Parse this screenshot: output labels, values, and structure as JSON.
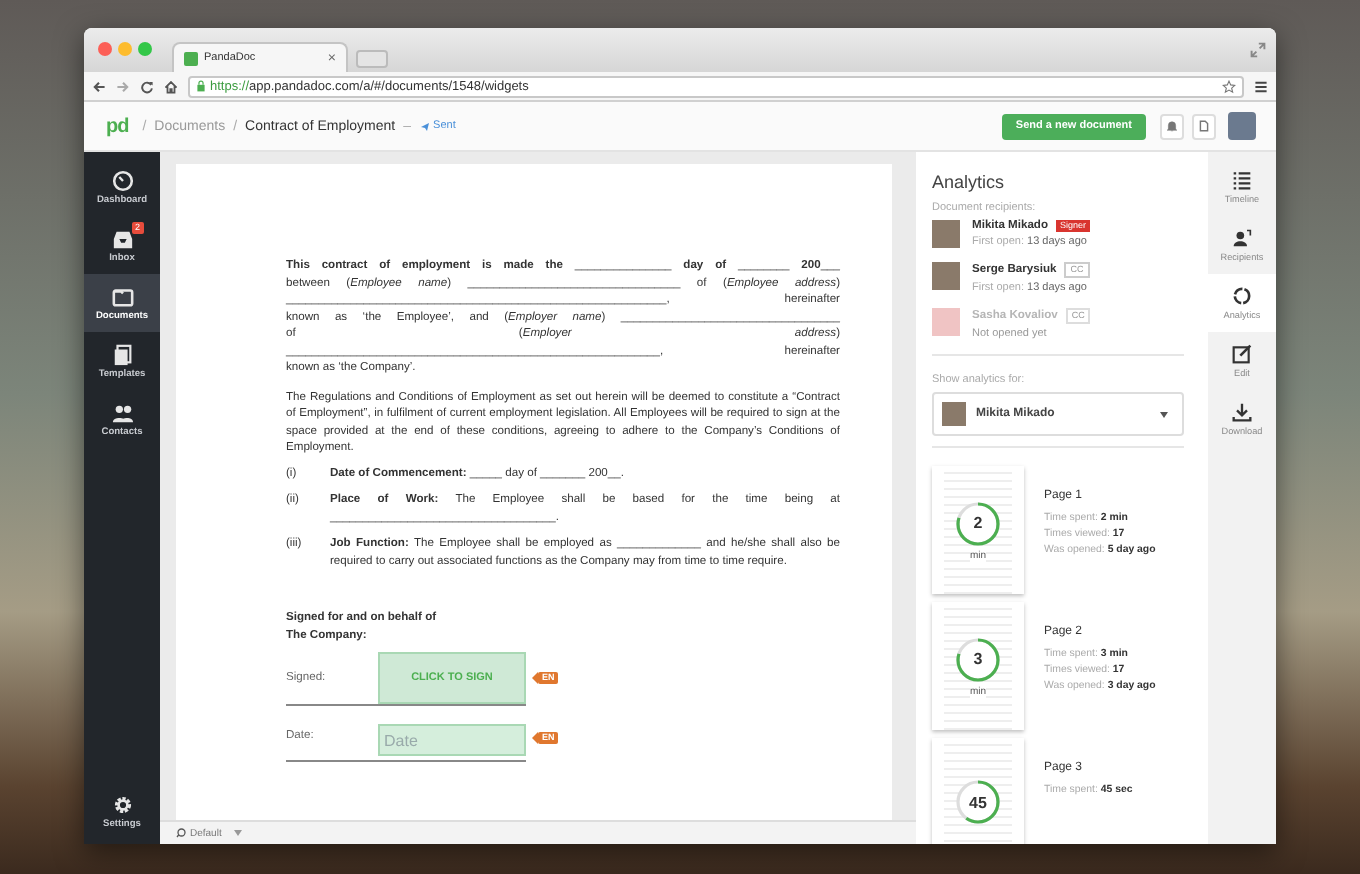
{
  "browser": {
    "tab_title": "PandaDoc",
    "tab_close": "×",
    "url_scheme": "https://",
    "url_rest": "app.pandadoc.com/a/#/documents/1548/widgets"
  },
  "header": {
    "logo": "pd",
    "breadcrumbs": [
      {
        "separator": "/",
        "label": "Documents",
        "current": false
      },
      {
        "separator": "/",
        "label": "Contract of Employment",
        "current": true
      }
    ],
    "status": {
      "separator": "–",
      "label": "Sent"
    },
    "send_button": "Send a new document"
  },
  "sidebar": {
    "items": [
      {
        "label": "Dashboard",
        "kind": "dashboard",
        "selected": false
      },
      {
        "label": "Inbox",
        "kind": "inbox",
        "selected": false,
        "badge": "2"
      },
      {
        "label": "Documents",
        "kind": "documents",
        "selected": true
      },
      {
        "label": "Templates",
        "kind": "templates",
        "selected": false
      },
      {
        "label": "Contacts",
        "kind": "contacts",
        "selected": false
      }
    ],
    "settings": "Settings"
  },
  "document": {
    "intro_lines": [
      "**This contract of employment is made the** _______________ **day of** ________ **200**___",
      "between (*Employee name*) _________________________________ of (*Employee address*)",
      "___________________________________________________________, hereinafter",
      "known as ‘the Employee’, and (*Employer name*) __________________________________",
      "of (*Employer address*)",
      "__________________________________________________________, hereinafter",
      "known as ‘the Company’."
    ],
    "paragraph": "The Regulations and Conditions of Employment as set out herein will be deemed to constitute a “Contract of Employment”, in fulfilment of current employment legislation. All Employees will be required to sign at the space provided at the end of these conditions, agreeing to adhere to the Company’s Conditions of Employment.",
    "clauses": [
      {
        "number": "(i)",
        "text": "**Date of Commencement:** _____ day of _______ 200__."
      },
      {
        "number": "(ii)",
        "text": "**Place of Work:** The Employee shall be based for the time being at ___________________________________."
      },
      {
        "number": "(iii)",
        "text": "**Job Function:** The Employee shall be employed as _____________ and he/she shall also be required to carry out associated functions as the Company may from time to time require."
      }
    ],
    "signature_heading": [
      "Signed for and on behalf of",
      "The Company:"
    ],
    "fields": [
      {
        "label": "Signed:",
        "kind": "signature",
        "button": "CLICK TO SIGN",
        "tag": "EN"
      },
      {
        "label": "Date:",
        "kind": "date",
        "placeholder": "Date",
        "tag": "EN"
      }
    ]
  },
  "status_bar": {
    "label": "Default"
  },
  "analytics": {
    "title": "Analytics",
    "recipients_label": "Document recipients:",
    "recipients": [
      {
        "name": "Mikita Mikado",
        "role": "Signer",
        "kind": "signer",
        "opened": true,
        "status_label": "First open:",
        "status_value": "13 days ago"
      },
      {
        "name": "Serge Barysiuk",
        "role": "CC",
        "kind": "cc",
        "opened": true,
        "status_label": "First open:",
        "status_value": "13 days ago"
      },
      {
        "name": "Sasha Kovaliov",
        "role": "CC",
        "kind": "cc",
        "opened": false,
        "status_label": "Not opened yet"
      }
    ],
    "show_for_label": "Show analytics for:",
    "show_for_value": "Mikita Mikado",
    "pages": [
      {
        "title": "Page 1",
        "number": "2",
        "unit": "min",
        "level": 0.8,
        "stats": [
          {
            "label": "Time spent:",
            "value": "2 min"
          },
          {
            "label": "Times viewed:",
            "value": "17"
          },
          {
            "label": "Was opened:",
            "value": "5 day ago"
          }
        ]
      },
      {
        "title": "Page 2",
        "number": "3",
        "unit": "min",
        "level": 0.8,
        "stats": [
          {
            "label": "Time spent:",
            "value": "3 min"
          },
          {
            "label": "Times viewed:",
            "value": "17"
          },
          {
            "label": "Was opened:",
            "value": "3 day ago"
          }
        ]
      },
      {
        "title": "Page 3",
        "number": "45",
        "level": 0.6,
        "stats": [
          {
            "label": "Time spent:",
            "value": "45 sec"
          }
        ]
      }
    ]
  },
  "tools": [
    {
      "label": "Timeline",
      "kind": "timeline",
      "selected": false
    },
    {
      "label": "Recipients",
      "kind": "recipients",
      "selected": false
    },
    {
      "label": "Analytics",
      "kind": "analytics",
      "selected": true
    },
    {
      "label": "Edit",
      "kind": "edit",
      "selected": false
    },
    {
      "label": "Download",
      "kind": "download",
      "selected": false
    }
  ]
}
